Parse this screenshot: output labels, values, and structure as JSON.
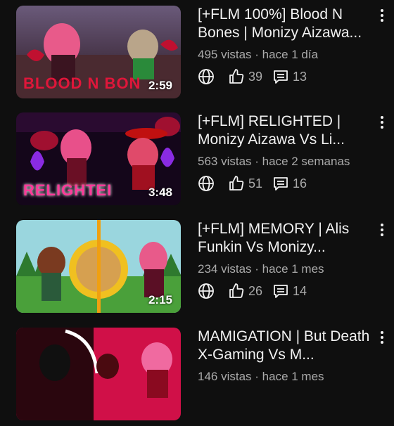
{
  "videos": [
    {
      "title": "[+FLM 100%] Blood N Bones | Monizy Aizawa...",
      "views": "495 vistas",
      "age": "hace 1 día",
      "likes": "39",
      "comments": "13",
      "duration": "2:59",
      "overlay_text": "BLOOD N BON",
      "colors": {
        "bg1": "#5a3a5a",
        "bg2": "#2a1a25",
        "text": "#e0163a"
      }
    },
    {
      "title": "[+FLM] RELIGHTED | Monizy Aizawa Vs Li...",
      "views": "563 vistas",
      "age": "hace 2 semanas",
      "likes": "51",
      "comments": "16",
      "duration": "3:48",
      "overlay_text": "RELIGHTEI",
      "colors": {
        "bg1": "#2a0a3a",
        "bg2": "#100514",
        "text": "#ff3a9a"
      }
    },
    {
      "title": "[+FLM] MEMORY | Alis Funkin Vs Monizy...",
      "views": "234 vistas",
      "age": "hace 1 mes",
      "likes": "26",
      "comments": "14",
      "duration": "2:15",
      "overlay_text": "",
      "colors": {
        "bg1": "#8ed0d8",
        "bg2": "#4a9a3a",
        "text": "#ffffff"
      }
    },
    {
      "title": "MAMIGATION | But Death X-Gaming Vs M...",
      "views": "146 vistas",
      "age": "hace 1 mes",
      "likes": "",
      "comments": "",
      "duration": "",
      "overlay_text": "",
      "colors": {
        "bg1": "#d01048",
        "bg2": "#3a0512",
        "text": "#ffffff"
      }
    }
  ],
  "separator": " · ",
  "icons": {
    "visibility": "globe-icon",
    "like": "thumbs-up-icon",
    "comment": "comment-icon",
    "menu": "more-vert-icon"
  }
}
